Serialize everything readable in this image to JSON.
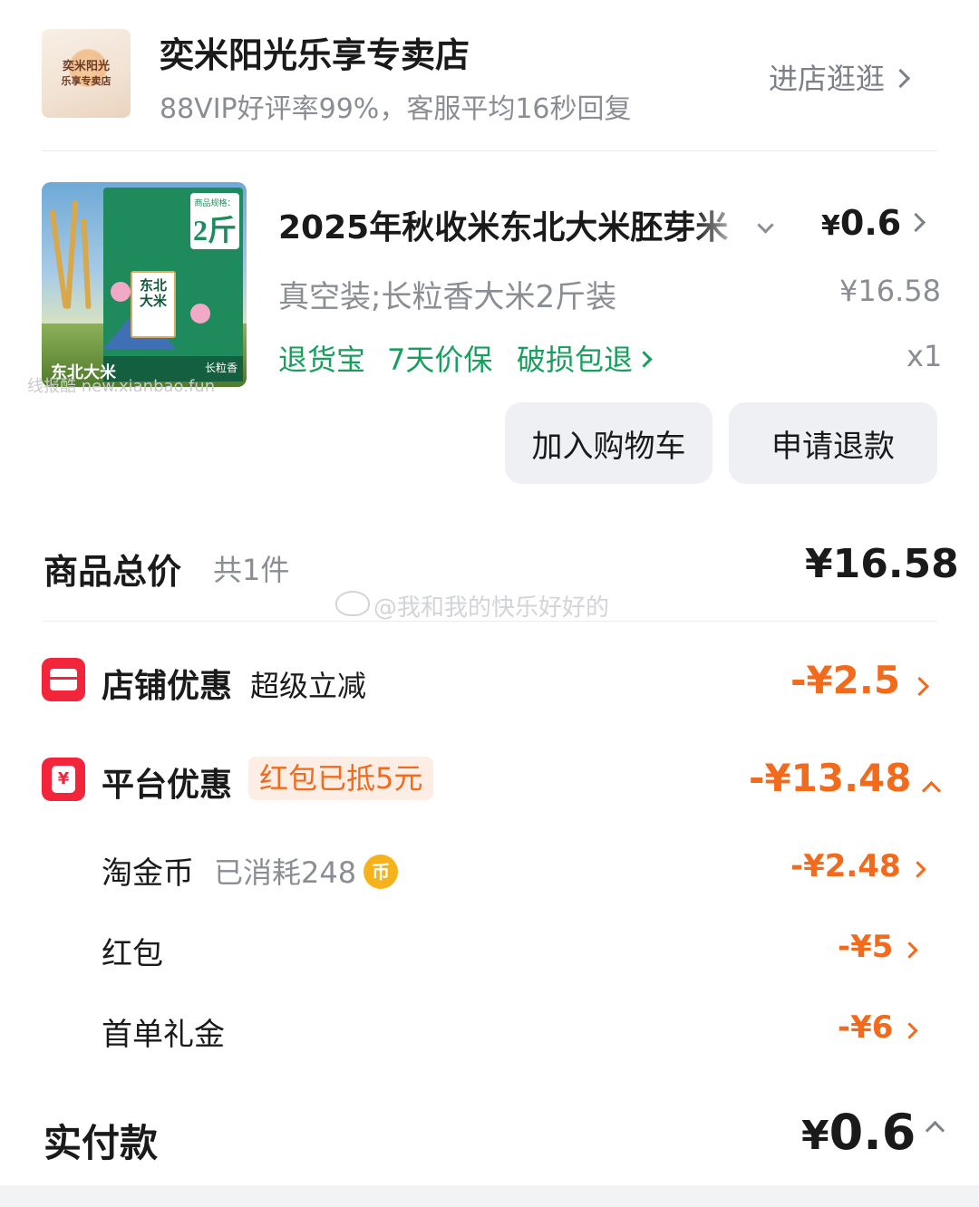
{
  "shop": {
    "logo_text_line1": "奕米阳光",
    "logo_text_line2": "乐享专卖店",
    "name": "奕米阳光乐享专卖店",
    "meta": "88VIP好评率99%，客服平均16秒回复",
    "enter_label": "进店逛逛"
  },
  "product": {
    "image_badge_small": "商品规格：",
    "image_badge_big": "2斤",
    "image_bag_label": "东北大米",
    "image_caption": "东北大米",
    "image_band_right": "长粒香",
    "watermark": "线报酷 new.xianbao.fun",
    "title": "2025年秋收米东北大米胚芽米",
    "price_currency": "¥",
    "price_value": "0.6",
    "sku": "真空装;长粒香大米2斤装",
    "original_price": "¥16.58",
    "services": [
      "退货宝",
      "7天价保",
      "破损包退"
    ],
    "quantity": "x1"
  },
  "actions": {
    "add_to_cart": "加入购物车",
    "refund": "申请退款"
  },
  "totals": {
    "goods_total_label": "商品总价",
    "goods_count": "共1件",
    "goods_total_amount": "¥16.58",
    "weibo_watermark": "@我和我的快乐好好的"
  },
  "discounts": {
    "store": {
      "label": "店铺优惠",
      "sub": "超级立减",
      "amount": "-¥2.5"
    },
    "platform": {
      "label": "平台优惠",
      "badge": "红包已抵5元",
      "amount": "-¥13.48",
      "items": [
        {
          "label": "淘金币",
          "sub": "已消耗248",
          "coin_glyph": "币",
          "amount": "-¥2.48"
        },
        {
          "label": "红包",
          "sub": "",
          "amount": "-¥5"
        },
        {
          "label": "首单礼金",
          "sub": "",
          "amount": "-¥6"
        }
      ]
    }
  },
  "actual": {
    "label": "实付款",
    "currency": "¥",
    "value": "0.6"
  },
  "colors": {
    "accent_orange": "#f26a1b",
    "service_green": "#17a05d",
    "discount_icon_red": "#f2253a"
  }
}
